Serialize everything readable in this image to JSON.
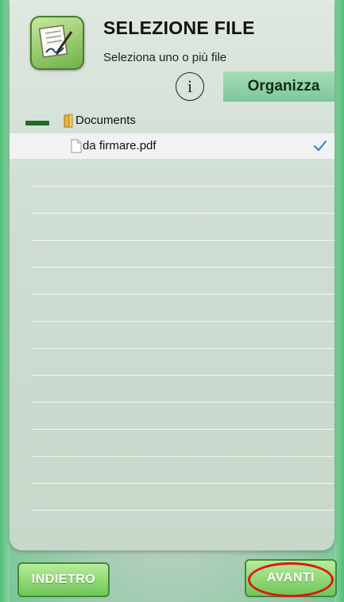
{
  "header": {
    "title": "SELEZIONE FILE",
    "subtitle": "Seleziona uno o più file",
    "app_icon": "signature-document-icon"
  },
  "toolbar": {
    "info_label": "i",
    "organize_label": "Organizza"
  },
  "tree": {
    "folder": {
      "label": "Documents",
      "icon": "folder-icon",
      "expand_icon": "minus-icon"
    },
    "files": [
      {
        "label": "da firmare.pdf",
        "icon": "file-icon",
        "selected": true,
        "check_icon": "checkmark-icon"
      }
    ]
  },
  "footer": {
    "back_label": "INDIETRO",
    "next_label": "AVANTI",
    "highlight_color": "#e0141c"
  },
  "colors": {
    "accent_green": "#7ec79a",
    "check_blue": "#2a7de1"
  }
}
